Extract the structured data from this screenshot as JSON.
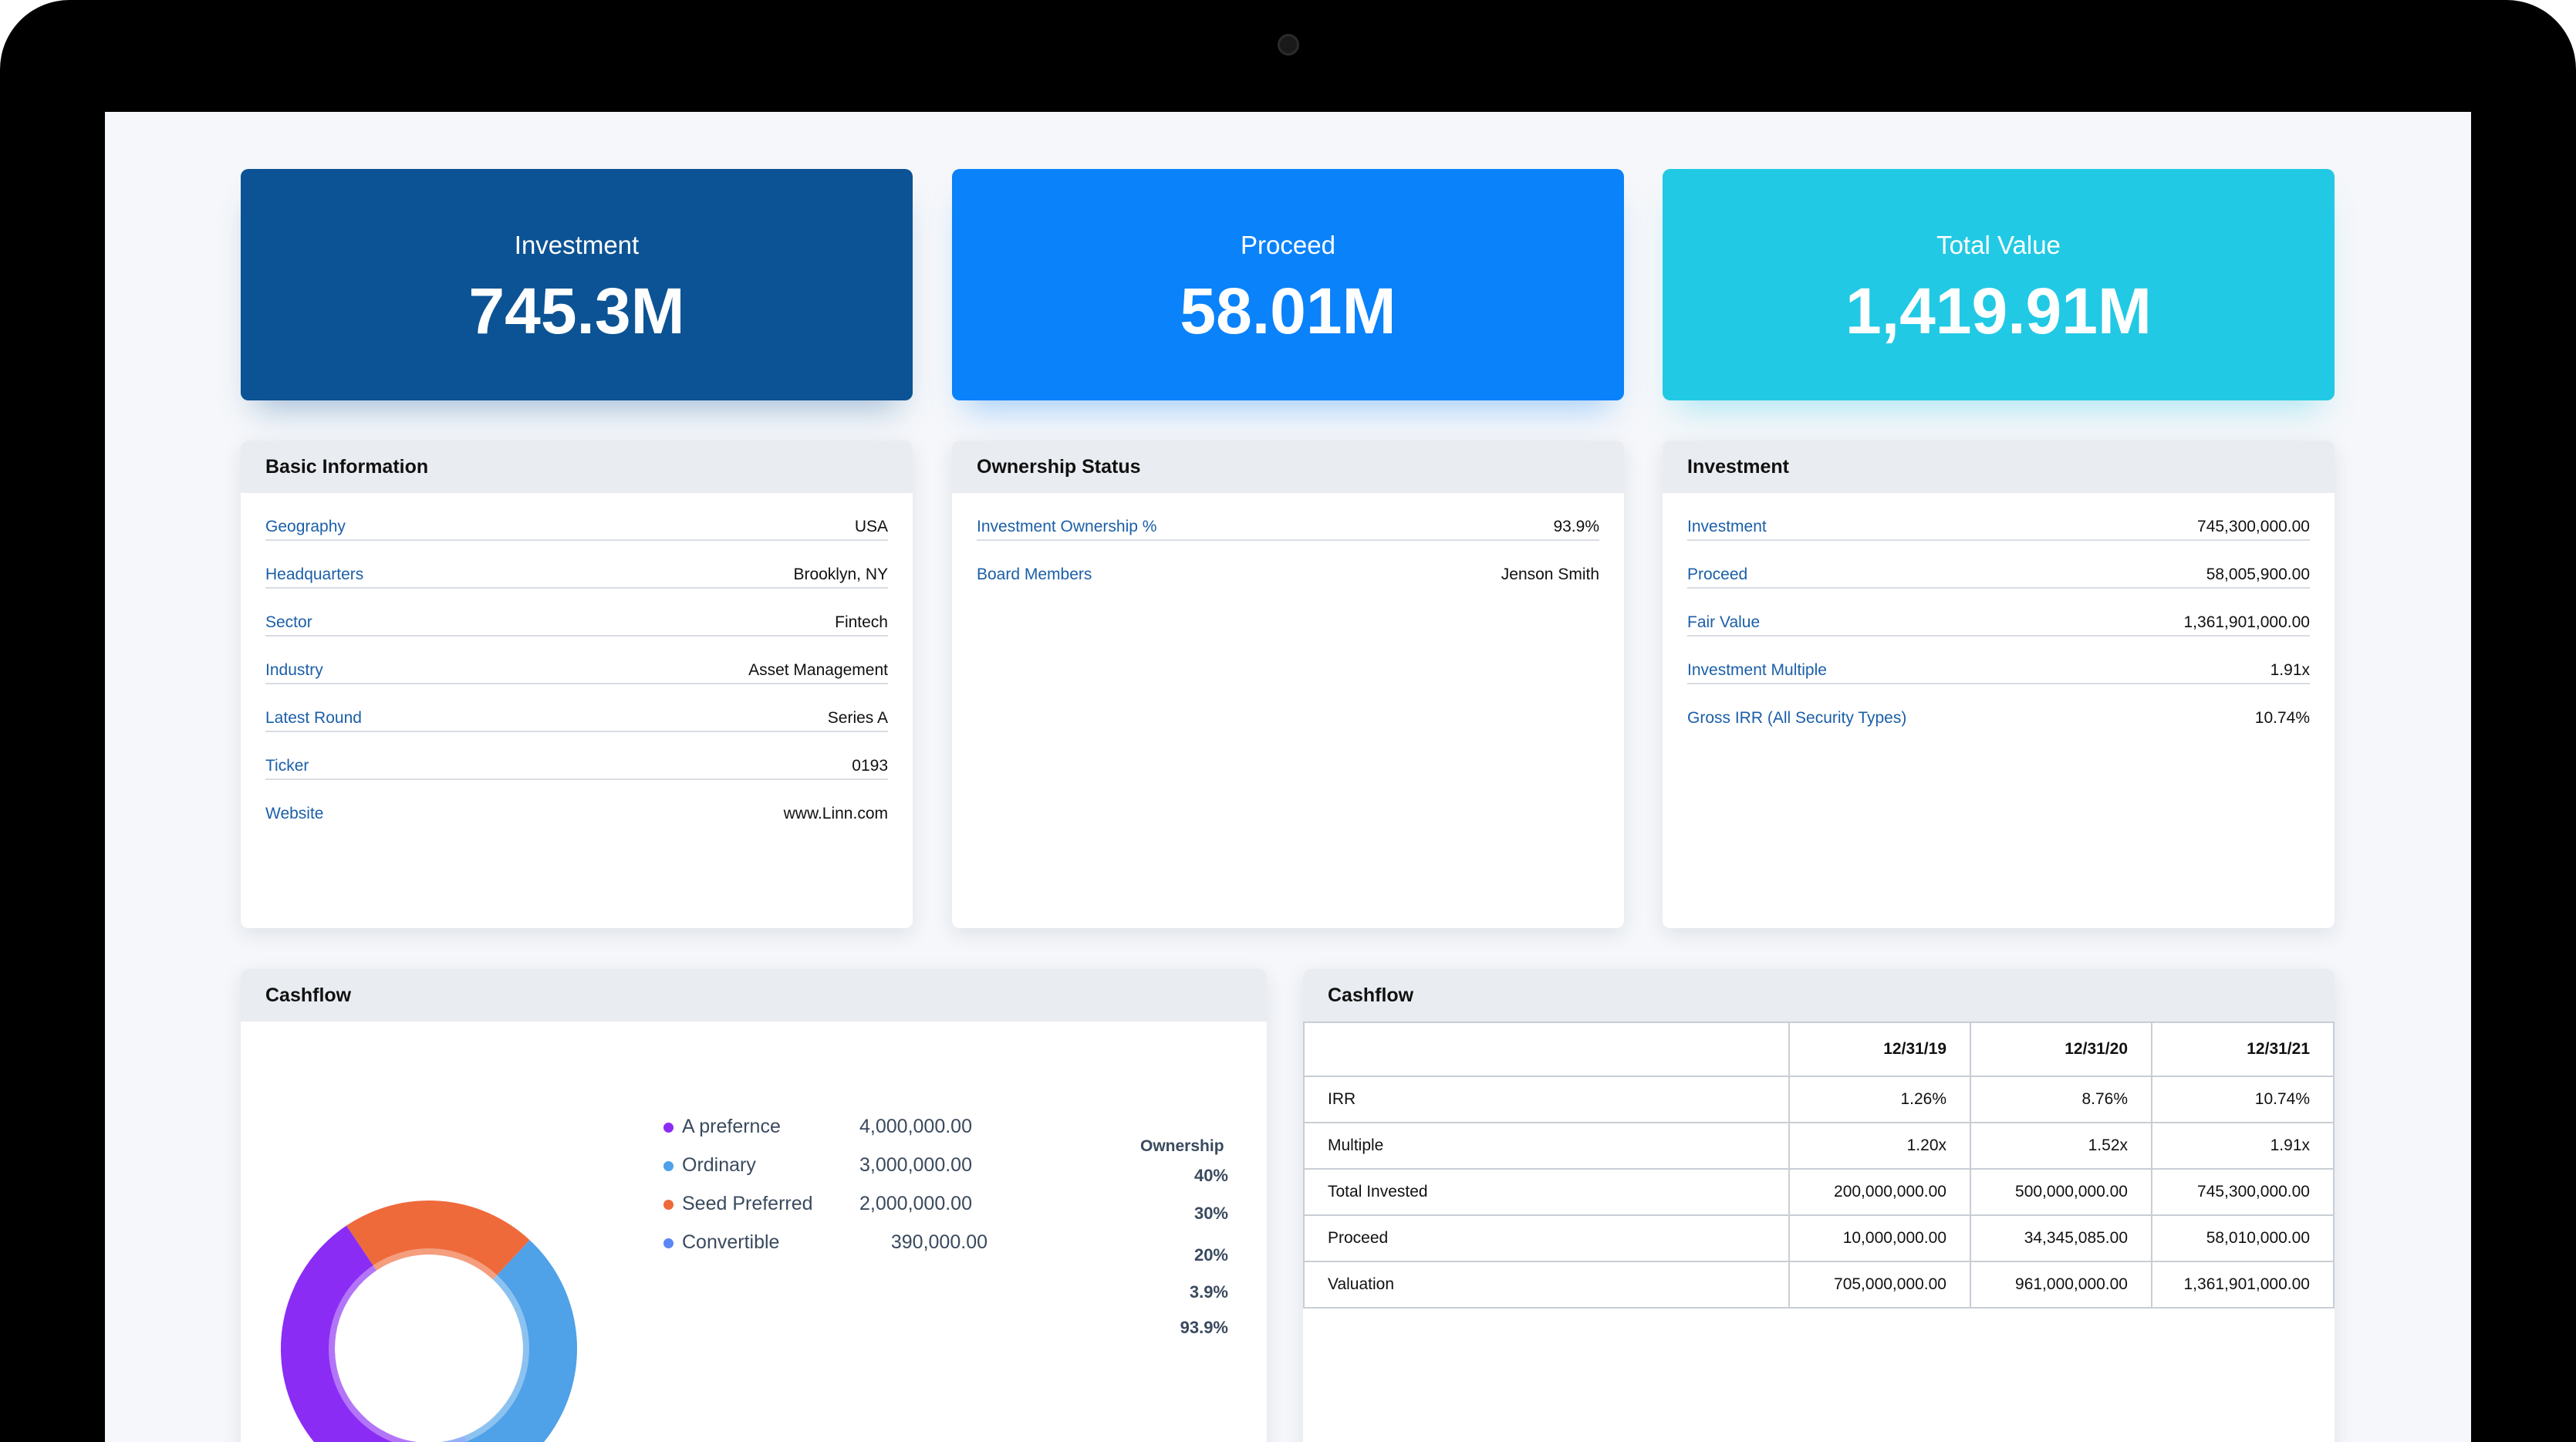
{
  "kpis": [
    {
      "label": "Investment",
      "value": "745.3M",
      "color": "#0b5394"
    },
    {
      "label": "Proceed",
      "value": "58.01M",
      "color": "#0a82fa"
    },
    {
      "label": "Total Value",
      "value": "1,419.91M",
      "color": "#22c9e4"
    }
  ],
  "basic_info": {
    "title": "Basic Information",
    "rows": [
      {
        "key": "Geography",
        "value": "USA"
      },
      {
        "key": "Headquarters",
        "value": "Brooklyn, NY"
      },
      {
        "key": "Sector",
        "value": "Fintech"
      },
      {
        "key": "Industry",
        "value": "Asset Management"
      },
      {
        "key": "Latest Round",
        "value": "Series A"
      },
      {
        "key": "Ticker",
        "value": "0193"
      },
      {
        "key": "Website",
        "value": "www.Linn.com"
      }
    ]
  },
  "ownership": {
    "title": "Ownership Status",
    "rows": [
      {
        "key": "Investment Ownership %",
        "value": "93.9%"
      },
      {
        "key": "Board Members",
        "value": "Jenson Smith"
      }
    ]
  },
  "investment": {
    "title": "Investment",
    "rows": [
      {
        "key": "Investment",
        "value": "745,300,000.00"
      },
      {
        "key": "Proceed",
        "value": "58,005,900.00"
      },
      {
        "key": "Fair Value",
        "value": "1,361,901,000.00"
      },
      {
        "key": "Investment Multiple",
        "value": "1.91x"
      },
      {
        "key": "Gross IRR (All Security Types)",
        "value": "10.74%"
      }
    ]
  },
  "cashflow_chart": {
    "title": "Cashflow",
    "ownership_header": "Ownership",
    "ownership_pcts": [
      "40%",
      "30%",
      "20%",
      "3.9%",
      "93.9%"
    ]
  },
  "chart_data": {
    "type": "pie",
    "categories": [
      "A prefernce",
      "Ordinary",
      "Seed Preferred",
      "Convertible"
    ],
    "values": [
      4000000,
      3000000,
      2000000,
      390000
    ],
    "labels": [
      "4,000,000.00",
      "3,000,000.00",
      "2,000,000.00",
      "390,000.00"
    ],
    "colors": [
      "#8b2cf5",
      "#4fa1e8",
      "#ee6a3a",
      "#5b86f5"
    ],
    "donut_colors": [
      "#8b2cf5",
      "#ee6a3a",
      "#4fa1e8",
      "#5b86f5"
    ],
    "title": ""
  },
  "cashflow_table": {
    "title": "Cashflow",
    "columns": [
      "",
      "12/31/19",
      "12/31/20",
      "12/31/21"
    ],
    "rows": [
      {
        "label": "IRR",
        "values": [
          "1.26%",
          "8.76%",
          "10.74%"
        ]
      },
      {
        "label": "Multiple",
        "values": [
          "1.20x",
          "1.52x",
          "1.91x"
        ]
      },
      {
        "label": "Total Invested",
        "values": [
          "200,000,000.00",
          "500,000,000.00",
          "745,300,000.00"
        ]
      },
      {
        "label": "Proceed",
        "values": [
          "10,000,000.00",
          "34,345,085.00",
          "58,010,000.00"
        ]
      },
      {
        "label": "Valuation",
        "values": [
          "705,000,000.00",
          "961,000,000.00",
          "1,361,901,000.00"
        ]
      }
    ]
  }
}
